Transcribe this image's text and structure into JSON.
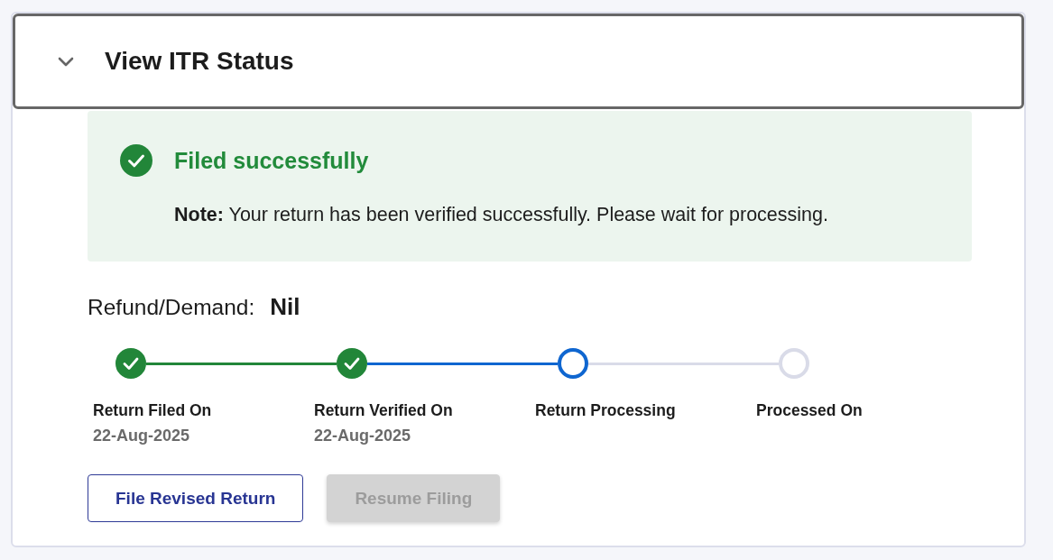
{
  "accordion": {
    "title": "View ITR Status",
    "expanded": true
  },
  "alert": {
    "kind": "success",
    "title": "Filed successfully",
    "note": "**Note:** Your return has been verified successfully. Please wait for processing."
  },
  "refund": {
    "label": "Refund/Demand:",
    "value": "Nil"
  },
  "steps": [
    {
      "label": "Return Filed On",
      "date": "22-Aug-2025",
      "done": true,
      "current": false
    },
    {
      "label": "Return Verified On",
      "date": "22-Aug-2025",
      "done": true,
      "current": false
    },
    {
      "label": "Return Processing",
      "done": false,
      "current": true
    },
    {
      "label": "Processed On",
      "done": false,
      "current": false
    }
  ],
  "buttons": [
    {
      "label": "File Revised Return",
      "disabled": false
    },
    {
      "label": "Resume Filing",
      "disabled": true
    }
  ]
}
